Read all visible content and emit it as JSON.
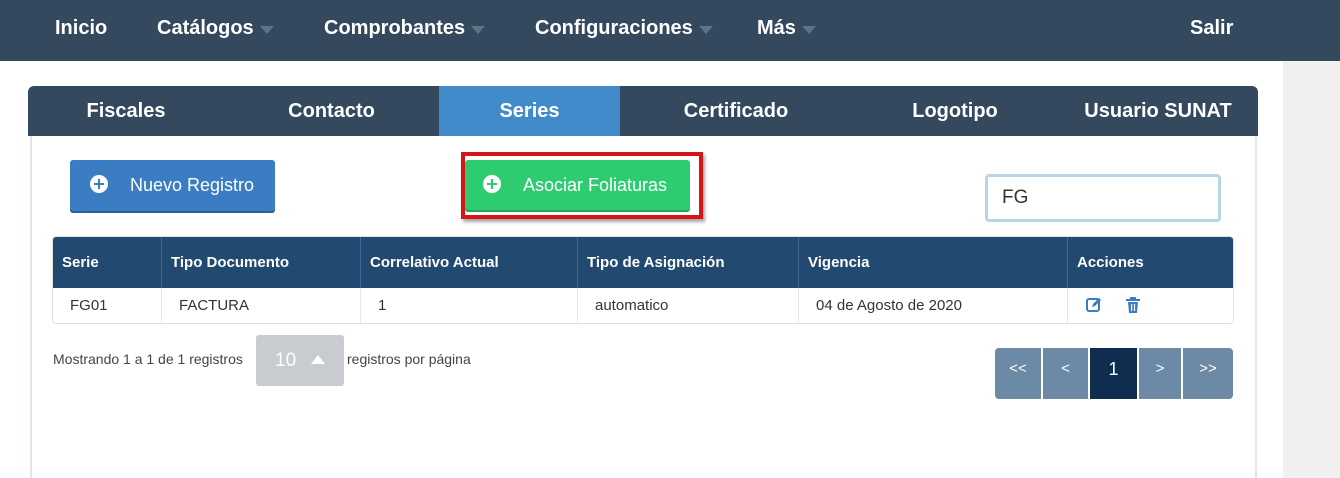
{
  "nav": {
    "inicio": "Inicio",
    "catalogos": "Catálogos",
    "comprobantes": "Comprobantes",
    "configuraciones": "Configuraciones",
    "mas": "Más",
    "salir": "Salir"
  },
  "tabs": [
    "Fiscales",
    "Contacto",
    "Series",
    "Certificado",
    "Logotipo",
    "Usuario SUNAT"
  ],
  "active_tab": "Series",
  "buttons": {
    "new_record": "Nuevo Registro",
    "associate": "Asociar Foliaturas"
  },
  "search": {
    "value": "FG"
  },
  "table": {
    "headers": [
      "Serie",
      "Tipo Documento",
      "Correlativo Actual",
      "Tipo de Asignación",
      "Vigencia",
      "Acciones"
    ],
    "rows": [
      [
        "FG01",
        "FACTURA",
        "1",
        "automatico",
        "04 de Agosto de 2020"
      ]
    ]
  },
  "footer": {
    "showing": "Mostrando 1 a 1 de 1 registros",
    "page_size": "10",
    "per_page": "registros por página"
  },
  "pagination": {
    "first": "<<",
    "prev": "<",
    "current": "1",
    "next": ">",
    "last": ">>"
  },
  "colors": {
    "navbar": "#34495e",
    "tab_active": "#428bca",
    "table_header": "#224a70",
    "btn_new": "#3b7dc3",
    "btn_associate": "#2ecc71",
    "highlight": "#d61616",
    "page_active": "#0e2d4f"
  },
  "icons": [
    "edit-icon",
    "trash-icon",
    "plus-circle-icon",
    "caret-down-icon",
    "caret-up-icon"
  ]
}
